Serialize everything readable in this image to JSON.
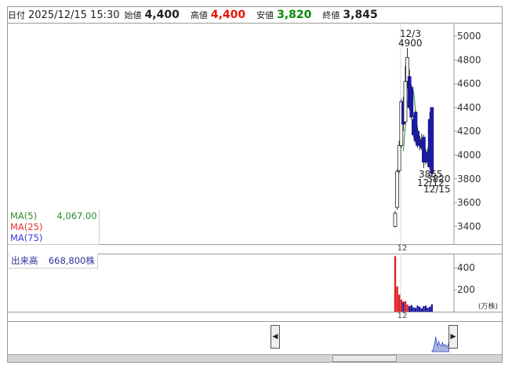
{
  "header": {
    "date_label": "日付",
    "date_value": "2025/12/15 15:30",
    "open_label": "始値",
    "open_value": "4,400",
    "high_label": "高値",
    "high_value": "4,400",
    "low_label": "安値",
    "low_value": "3,820",
    "close_label": "終値",
    "close_value": "3,845",
    "colors": {
      "high": "#e8140a",
      "low": "#0a8a0a",
      "default": "#222222"
    }
  },
  "legend": {
    "ma5_label": "MA(5)",
    "ma5_value": "4,067.00",
    "ma25_label": "MA(25)",
    "ma75_label": "MA(75)",
    "volume_label": "出来高",
    "volume_value": "668,800株",
    "colors": {
      "ma5": "#2e8b2e",
      "ma25": "#e83030",
      "ma75": "#3a3adf"
    }
  },
  "annotations": {
    "high_date": "12/3",
    "high_price": "4900",
    "low_price_a": "3865",
    "low_price_b": "3820",
    "low_date_a": "12/12",
    "low_date_b": "12/15"
  },
  "axis": {
    "x_tick_main": "12",
    "x_tick_volume": "12",
    "volume_unit": "(万株)"
  },
  "chart_data": [
    {
      "type": "candlestick",
      "ylim": [
        3250,
        5100
      ],
      "yticks": [
        3400,
        3600,
        3800,
        4000,
        4200,
        4400,
        4600,
        4800,
        5000
      ],
      "colors": {
        "up": "#ffffff",
        "down": "#1a1aa0",
        "wick": "#222222",
        "ma5": "#2e8b2e"
      },
      "candles": [
        {
          "o": 3400,
          "h": 3530,
          "l": 3390,
          "c": 3510
        },
        {
          "o": 3560,
          "h": 3880,
          "l": 3540,
          "c": 3860
        },
        {
          "o": 3870,
          "h": 4120,
          "l": 3850,
          "c": 4080
        },
        {
          "o": 4080,
          "h": 4470,
          "l": 4060,
          "c": 4450
        },
        {
          "o": 4450,
          "h": 4490,
          "l": 4200,
          "c": 4260
        },
        {
          "o": 4280,
          "h": 4750,
          "l": 4260,
          "c": 4620
        },
        {
          "o": 4620,
          "h": 4900,
          "l": 4560,
          "c": 4820
        },
        {
          "o": 4660,
          "h": 4720,
          "l": 4380,
          "c": 4400
        },
        {
          "o": 4570,
          "h": 4590,
          "l": 4300,
          "c": 4320
        },
        {
          "o": 4300,
          "h": 4330,
          "l": 4150,
          "c": 4170
        },
        {
          "o": 4360,
          "h": 4380,
          "l": 4100,
          "c": 4120
        },
        {
          "o": 4200,
          "h": 4230,
          "l": 4060,
          "c": 4080
        },
        {
          "o": 4100,
          "h": 4160,
          "l": 4040,
          "c": 4090
        },
        {
          "o": 4130,
          "h": 4180,
          "l": 4040,
          "c": 4060
        },
        {
          "o": 4150,
          "h": 4170,
          "l": 3890,
          "c": 3940
        },
        {
          "o": 4010,
          "h": 4040,
          "l": 3920,
          "c": 3960
        },
        {
          "o": 4020,
          "h": 4060,
          "l": 3900,
          "c": 3940
        },
        {
          "o": 4300,
          "h": 4360,
          "l": 3880,
          "c": 3900
        },
        {
          "o": 4400,
          "h": 4400,
          "l": 3820,
          "c": 3845
        }
      ],
      "ma5": [
        null,
        null,
        null,
        null,
        4032,
        4254,
        4450,
        4470,
        4484,
        4538,
        4366,
        4218,
        4156,
        4104,
        4098,
        4044,
        4016,
        3976,
        3937
      ]
    },
    {
      "type": "bar",
      "ylim": [
        0,
        500
      ],
      "yticks": [
        200,
        400
      ],
      "colors": {
        "up": "#e02020",
        "down": "#1a1aa0"
      },
      "values": [
        505,
        230,
        155,
        110,
        90,
        95,
        65,
        50,
        60,
        40,
        35,
        55,
        45,
        30,
        50,
        55,
        35,
        45,
        67
      ],
      "directions": [
        "up",
        "up",
        "up",
        "up",
        "down",
        "up",
        "up",
        "down",
        "down",
        "down",
        "down",
        "down",
        "down",
        "down",
        "down",
        "down",
        "down",
        "down",
        "down"
      ]
    },
    {
      "type": "area",
      "values": [
        0.05,
        0.06,
        0.3,
        0.5,
        0.8,
        0.45,
        0.3,
        0.55,
        0.4,
        0.35,
        0.3,
        0.5,
        0.35,
        0.3,
        0.4,
        0.3,
        0.25,
        0.35,
        0.55
      ],
      "colors": {
        "fill": "#a9b4e6",
        "stroke": "#3a4abf"
      }
    }
  ]
}
